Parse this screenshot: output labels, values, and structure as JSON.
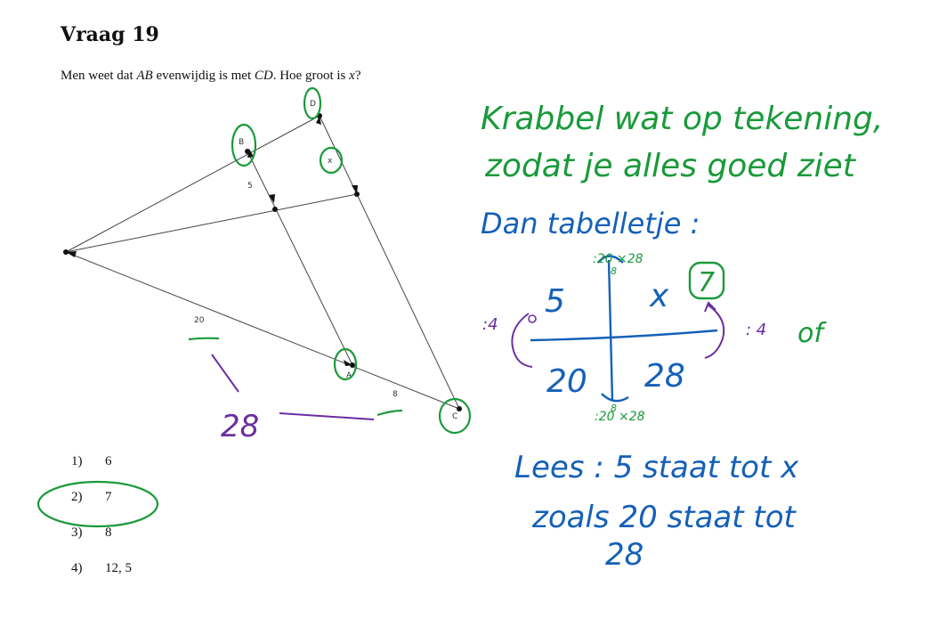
{
  "title": "Vraag 19",
  "question": {
    "part1": "Men weet dat ",
    "ab": "AB",
    "part2": " evenwijdig is met ",
    "cd": "CD",
    "part3": ". Hoe groot is ",
    "x": "x",
    "part4": "?"
  },
  "figure": {
    "label_a": "A",
    "label_b": "B",
    "label_c": "C",
    "label_d": "D",
    "label_x": "x",
    "len_5": "5",
    "len_20": "20",
    "len_8": "8"
  },
  "answers": [
    {
      "num": "1)",
      "value": "6"
    },
    {
      "num": "2)",
      "value": "7"
    },
    {
      "num": "3)",
      "value": "8"
    },
    {
      "num": "4)",
      "value": "12, 5"
    }
  ],
  "annotations": {
    "green_line1": "Krabbel wat op tekening,",
    "green_line2": "zodat je alles goed ziet",
    "blue_line1": "Dan tabelletje :",
    "table_top_note": ":20 ×28",
    "table_top_note_sub": "8",
    "cell_5": "5",
    "cell_x": "x",
    "cell_7": "7",
    "cell_20": "20",
    "cell_28": "28",
    "side_left": ":4",
    "side_right": ": 4",
    "side_right_extra": "of",
    "table_bottom_note": ":20 ×28",
    "table_bottom_sub": "8",
    "read_line1": "Lees : 5 staat tot x",
    "read_line2": "zoals 20 staat tot",
    "read_line3": "28",
    "purple_28": "28",
    "colors": {
      "green": "#1a9a3a",
      "blue": "#1560b8",
      "purple": "#6b2ea0"
    }
  }
}
